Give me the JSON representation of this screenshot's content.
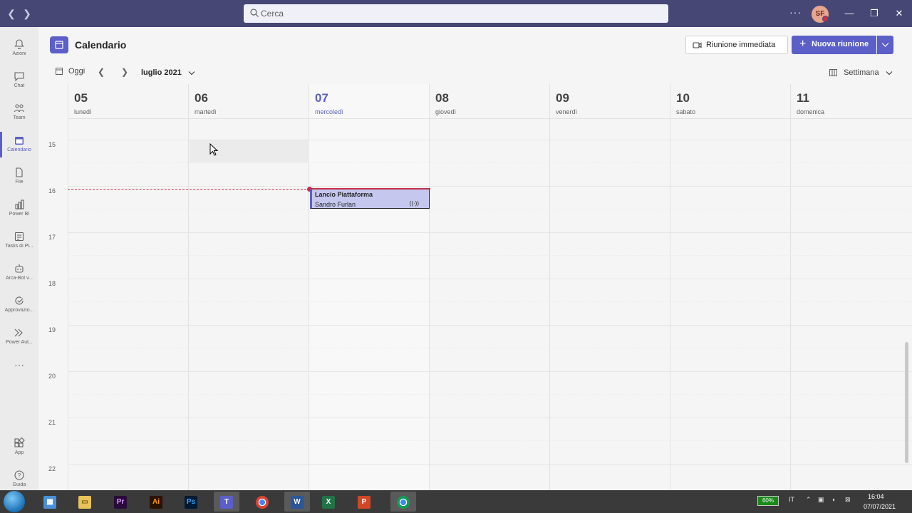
{
  "titlebar": {
    "search_placeholder": "Cerca",
    "more": "···",
    "avatar_initials": "SF",
    "minimize": "—",
    "maximize": "❐",
    "close": "✕"
  },
  "rail": {
    "items": [
      {
        "label": "Azioni",
        "icon": "bell-icon"
      },
      {
        "label": "Chat",
        "icon": "chat-icon"
      },
      {
        "label": "Team",
        "icon": "team-icon"
      },
      {
        "label": "Calendario",
        "icon": "calendar-icon"
      },
      {
        "label": "File",
        "icon": "file-icon"
      },
      {
        "label": "Power BI",
        "icon": "powerbi-icon"
      },
      {
        "label": "Tasks di Pl...",
        "icon": "tasks-icon"
      },
      {
        "label": "Arca-Bot v...",
        "icon": "bot-icon"
      },
      {
        "label": "Approvazio...",
        "icon": "approvals-icon"
      },
      {
        "label": "Power Aut...",
        "icon": "automate-icon"
      }
    ],
    "more": "···",
    "apps_label": "App",
    "help_label": "Guida"
  },
  "header": {
    "title": "Calendario",
    "meet_now": "Riunione immediata",
    "new_meeting": "Nuova riunione",
    "today": "Oggi",
    "month": "luglio 2021",
    "view": "Settimana"
  },
  "days": [
    {
      "num": "05",
      "name": "lunedì"
    },
    {
      "num": "06",
      "name": "martedì"
    },
    {
      "num": "07",
      "name": "mercoledì",
      "today": true
    },
    {
      "num": "08",
      "name": "giovedì"
    },
    {
      "num": "09",
      "name": "venerdì"
    },
    {
      "num": "10",
      "name": "sabato"
    },
    {
      "num": "11",
      "name": "domenica"
    }
  ],
  "hours": [
    "15",
    "16",
    "17",
    "18",
    "19",
    "20",
    "21",
    "22"
  ],
  "event": {
    "title": "Lancio Piattaforma",
    "organizer": "Sandro Furlan",
    "live_icon": "((·))"
  },
  "taskbar": {
    "apps": [
      "explorer",
      "filemanager",
      "premiere",
      "illustrator",
      "photoshop",
      "teams",
      "chrome",
      "word",
      "excel",
      "powerpoint",
      "chrome"
    ],
    "battery": "60%",
    "lang": "IT",
    "time": "16:04",
    "date": "07/07/2021"
  },
  "colors": {
    "titlebar": "#464775",
    "accent": "#5b5fc7",
    "now_line": "#c4314b",
    "event_bg": "#c5c7ef"
  }
}
